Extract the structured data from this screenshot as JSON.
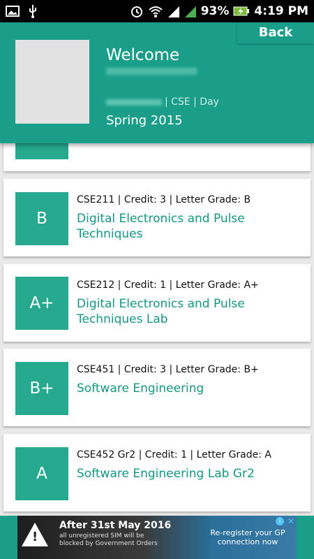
{
  "status_bar": {
    "battery": "93%",
    "time": "4:19 PM"
  },
  "header": {
    "back_label": "Back",
    "welcome": "Welcome",
    "dept_line": "| CSE | Day",
    "semester": "Spring 2015"
  },
  "courses": [
    {
      "grade": "B",
      "meta": "CSE211 | Credit: 3 | Letter Grade: B",
      "title": "Digital Electronics and Pulse Techniques"
    },
    {
      "grade": "A+",
      "meta": "CSE212 | Credit: 1 | Letter Grade: A+",
      "title": "Digital Electronics and Pulse Techniques Lab"
    },
    {
      "grade": "B+",
      "meta": "CSE451 | Credit: 3 | Letter Grade: B+",
      "title": "Software Engineering"
    },
    {
      "grade": "A",
      "meta": "CSE452 Gr2 | Credit: 1 | Letter Grade: A",
      "title": "Software Engineering Lab Gr2"
    }
  ],
  "ad": {
    "headline": "After 31st May 2016",
    "subtext": "all unregistered SIM will be blocked by Government Orders",
    "cta": "Re-register your GP connection now"
  },
  "colors": {
    "primary": "#1a9e89",
    "grade_box": "#26a98f",
    "title_text": "#139883"
  }
}
